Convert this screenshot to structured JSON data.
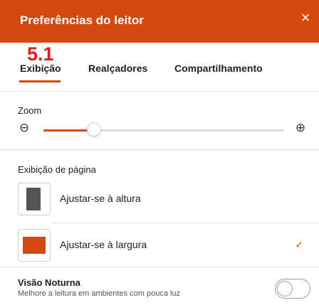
{
  "header": {
    "title": "Preferências do leitor",
    "close_icon": "×"
  },
  "step_label": "5.1",
  "tabs": [
    {
      "label": "Exibição",
      "active": true
    },
    {
      "label": "Realçadores",
      "active": false
    },
    {
      "label": "Compartilhamento",
      "active": false
    }
  ],
  "zoom": {
    "label": "Zoom",
    "minus_icon": "⊖",
    "plus_icon": "⊕",
    "level": 0.21
  },
  "page_display": {
    "label": "Exibição de página",
    "options": [
      {
        "label": "Ajustar-se à altura",
        "selected": false
      },
      {
        "label": "Ajustar-se à largura",
        "selected": true
      }
    ],
    "check_icon": "✓"
  },
  "night_mode": {
    "title": "Visão Noturna",
    "subtitle": "Melhore a leitura em ambientes com pouca luz",
    "enabled": false
  },
  "colors": {
    "accent": "#d4490f",
    "step_label": "#e01c1c",
    "fit_icon": "#555555"
  }
}
